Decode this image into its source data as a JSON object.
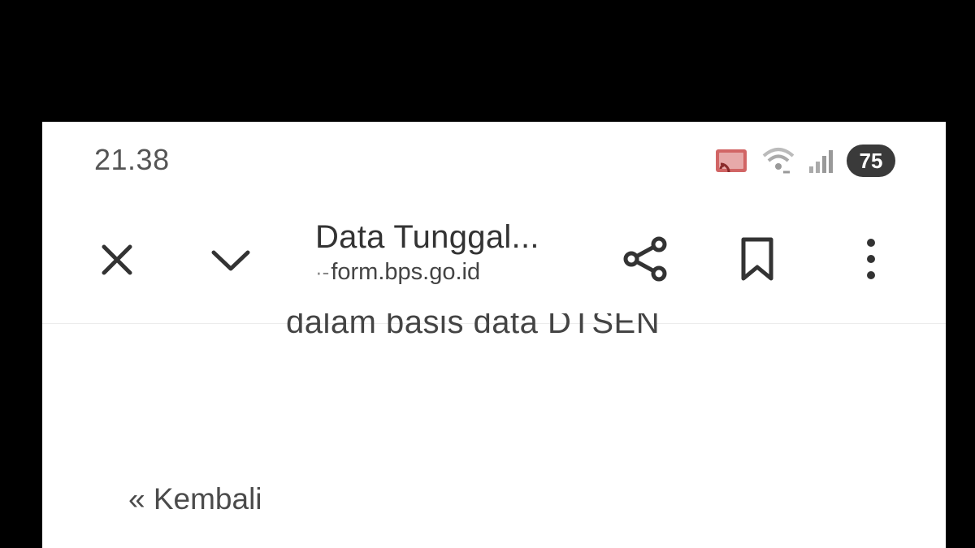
{
  "status_bar": {
    "time": "21.38",
    "battery": "75",
    "icons": [
      "cast-icon",
      "wifi-icon",
      "signal-icon"
    ]
  },
  "toolbar": {
    "title": "Data Tunggal...",
    "url_prefix": "·-",
    "url": "form.bps.go.id",
    "icons": [
      "close-icon",
      "chevron-down-icon",
      "share-icon",
      "bookmark-icon",
      "more-vert-icon"
    ]
  },
  "content": {
    "partial_text": "dalam basis data DTSEN",
    "back_link": "« Kembali"
  },
  "colors": {
    "frame": "#000000",
    "page": "#ffffff",
    "cast_accent": "#c94a4a"
  }
}
